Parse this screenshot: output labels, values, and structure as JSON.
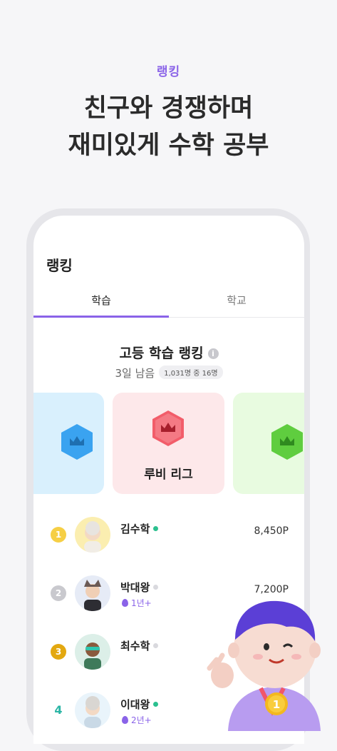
{
  "hero": {
    "tag": "랭킹",
    "title_line1": "친구와 경쟁하며",
    "title_line2": "재미있게 수학 공부"
  },
  "app": {
    "title": "랭킹",
    "tabs": [
      {
        "label": "학습",
        "active": true
      },
      {
        "label": "학교",
        "active": false
      }
    ]
  },
  "ranking": {
    "title": "고등 학습 랭킹",
    "info_icon": "i",
    "days_left": "3일 남음",
    "position_pill": "1,031명 중 16명"
  },
  "leagues": {
    "left": {
      "color": "#3aa3f0"
    },
    "center": {
      "name": "루비 리그",
      "color": "#f25d6a"
    },
    "right": {
      "color": "#5fcd3f"
    }
  },
  "rows": [
    {
      "rank": "1",
      "rank_color": "#f6cf45",
      "name": "김수학",
      "online": true,
      "level": "",
      "points": "8,450P"
    },
    {
      "rank": "2",
      "rank_color": "#c9c9ce",
      "name": "박대왕",
      "online": false,
      "level": "1년+",
      "points": "7,200P"
    },
    {
      "rank": "3",
      "rank_color": "#e3a810",
      "name": "최수학",
      "online": false,
      "level": "",
      "points": ""
    },
    {
      "rank": "4",
      "rank_color": "",
      "name": "이대왕",
      "online": true,
      "level": "2년+",
      "points": ""
    }
  ],
  "mascot": {
    "medal_number": "1"
  },
  "colors": {
    "accent": "#8a63e8",
    "online": "#2bc08f"
  }
}
